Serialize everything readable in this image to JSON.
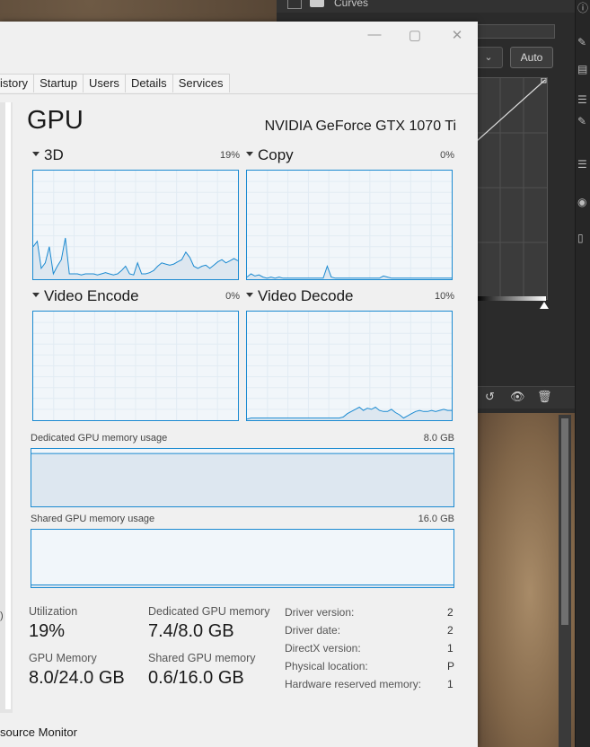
{
  "photoshop": {
    "panel_title": "Curves",
    "auto_label": "Auto"
  },
  "window": {
    "close_symbol": "✕",
    "minimize_symbol": "—",
    "maximize_symbol": "▢"
  },
  "tabs": [
    "istory",
    "Startup",
    "Users",
    "Details",
    "Services"
  ],
  "gpu": {
    "title": "GPU",
    "name": "NVIDIA GeForce GTX 1070 Ti"
  },
  "graphs": [
    {
      "label": "3D",
      "percent": "19%",
      "series": [
        0.3,
        0.35,
        0.1,
        0.15,
        0.3,
        0.05,
        0.12,
        0.18,
        0.38,
        0.05,
        0.05,
        0.05,
        0.04,
        0.05,
        0.05,
        0.05,
        0.04,
        0.05,
        0.06,
        0.05,
        0.04,
        0.05,
        0.08,
        0.12,
        0.05,
        0.04,
        0.15,
        0.05,
        0.05,
        0.06,
        0.08,
        0.12,
        0.15,
        0.14,
        0.13,
        0.14,
        0.16,
        0.18,
        0.25,
        0.2,
        0.12,
        0.1,
        0.12,
        0.13,
        0.1,
        0.13,
        0.16,
        0.18,
        0.15,
        0.17,
        0.19,
        0.17
      ]
    },
    {
      "label": "Copy",
      "percent": "0%",
      "series": [
        0.02,
        0.05,
        0.03,
        0.04,
        0.02,
        0.01,
        0.02,
        0.01,
        0.02,
        0.01,
        0.01,
        0.01,
        0.01,
        0.01,
        0.01,
        0.01,
        0.01,
        0.01,
        0.01,
        0.01,
        0.12,
        0.02,
        0.01,
        0.01,
        0.01,
        0.01,
        0.01,
        0.01,
        0.01,
        0.01,
        0.01,
        0.01,
        0.01,
        0.01,
        0.03,
        0.02,
        0.01,
        0.01,
        0.01,
        0.01,
        0.01,
        0.01,
        0.01,
        0.01,
        0.01,
        0.01,
        0.01,
        0.01,
        0.01,
        0.01,
        0.01,
        0.01
      ]
    },
    {
      "label": "Video Encode",
      "percent": "0%",
      "series": []
    },
    {
      "label": "Video Decode",
      "percent": "10%",
      "series": [
        0.01,
        0.02,
        0.02,
        0.02,
        0.02,
        0.02,
        0.02,
        0.02,
        0.02,
        0.02,
        0.02,
        0.02,
        0.02,
        0.02,
        0.02,
        0.02,
        0.02,
        0.02,
        0.02,
        0.02,
        0.02,
        0.02,
        0.02,
        0.02,
        0.03,
        0.06,
        0.08,
        0.1,
        0.12,
        0.09,
        0.11,
        0.1,
        0.12,
        0.09,
        0.08,
        0.08,
        0.1,
        0.07,
        0.05,
        0.02,
        0.04,
        0.06,
        0.08,
        0.09,
        0.08,
        0.08,
        0.09,
        0.08,
        0.09,
        0.1,
        0.09,
        0.09
      ]
    }
  ],
  "dedicated_memory": {
    "label": "Dedicated GPU memory usage",
    "max": "8.0 GB",
    "fill_fraction": 0.92
  },
  "shared_memory": {
    "label": "Shared GPU memory usage",
    "max": "16.0 GB",
    "fill_fraction": 0.04
  },
  "stats": {
    "utilization_label": "Utilization",
    "utilization": "19%",
    "dedicated_label": "Dedicated GPU memory",
    "dedicated": "7.4/8.0 GB",
    "gpu_memory_label": "GPU Memory",
    "gpu_memory": "8.0/24.0 GB",
    "shared_label": "Shared GPU memory",
    "shared": "0.6/16.0 GB"
  },
  "info": [
    {
      "label": "Driver version:",
      "value": "2"
    },
    {
      "label": "Driver date:",
      "value": "2"
    },
    {
      "label": "DirectX version:",
      "value": "1"
    },
    {
      "label": "Physical location:",
      "value": "P"
    },
    {
      "label": "Hardware reserved memory:",
      "value": "1"
    }
  ],
  "footer": {
    "link": "source Monitor"
  },
  "colors": {
    "accent": "#1b8ad1",
    "fill": "#dde7f0"
  }
}
